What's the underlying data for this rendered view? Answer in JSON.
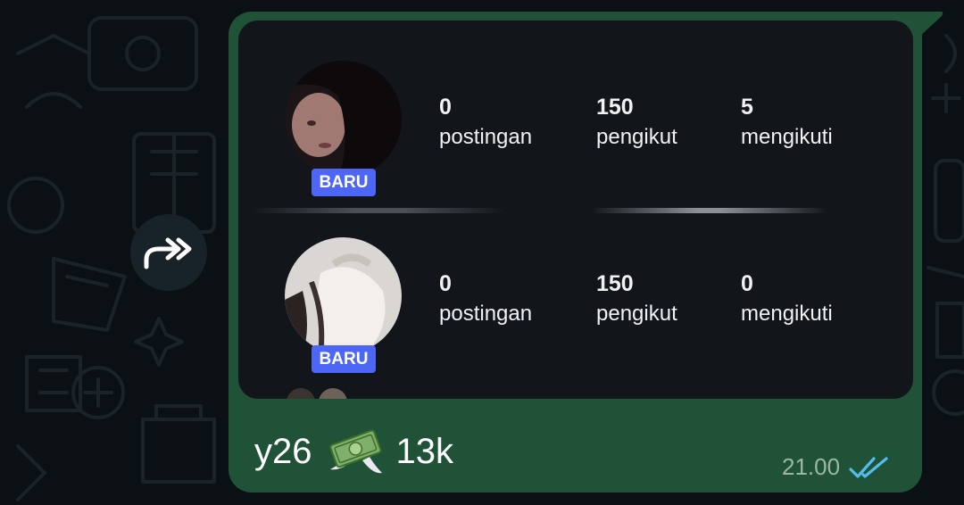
{
  "message": {
    "forward_icon": "forward-double-arrow-icon",
    "profiles": [
      {
        "badge": "BARU",
        "stats": [
          {
            "value": "0",
            "label": "postingan"
          },
          {
            "value": "150",
            "label": "pengikut"
          },
          {
            "value": "5",
            "label": "mengikuti"
          }
        ]
      },
      {
        "badge": "BARU",
        "stats": [
          {
            "value": "0",
            "label": "postingan"
          },
          {
            "value": "150",
            "label": "pengikut"
          },
          {
            "value": "0",
            "label": "mengikuti"
          }
        ]
      }
    ],
    "caption_before": "y26",
    "caption_emoji": "money-with-wings-icon",
    "caption_after": "13k",
    "time": "21.00",
    "status_icon": "double-check-read-icon"
  },
  "colors": {
    "chat_bg": "#0b1014",
    "bubble": "#1f5236",
    "badge": "#4d66f5",
    "read_ticks": "#53bdeb"
  }
}
